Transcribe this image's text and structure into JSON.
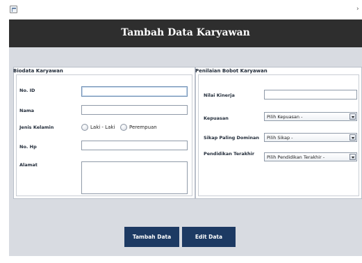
{
  "header": {
    "title": "Tambah Data Karyawan"
  },
  "biodata": {
    "title": "Biodata Karyawan",
    "id_label": "No. ID",
    "id_value": "",
    "nama_label": "Nama",
    "nama_value": "",
    "gender_label": "Jenis Kelamin",
    "gender_options": [
      "Laki - Laki",
      "Perempuan"
    ],
    "hp_label": "No. Hp",
    "hp_value": "",
    "alamat_label": "Alamat",
    "alamat_value": ""
  },
  "penilaian": {
    "title": "Penilaian Bobot Karyawan",
    "kinerja_label": "Nilai Kinerja",
    "kinerja_value": "",
    "kepuasan_label": "Kepuasan",
    "kepuasan_selected": "Pilih Kepuasan -",
    "sikap_label": "Sikap Paling Dominan",
    "sikap_selected": "Pilih Sikap -",
    "pendidikan_label": "Pendidikan Terakhir",
    "pendidikan_selected": "Pilih Pendidikan Terakhir -"
  },
  "buttons": {
    "tambah": "Tambah Data",
    "edit": "Edit Data"
  },
  "icons": {
    "window": "java-window-icon",
    "close": "close-icon"
  },
  "colors": {
    "header_bg": "#2e2e2e",
    "button_bg": "#1d3a63",
    "content_bg": "#d8dbe1"
  }
}
